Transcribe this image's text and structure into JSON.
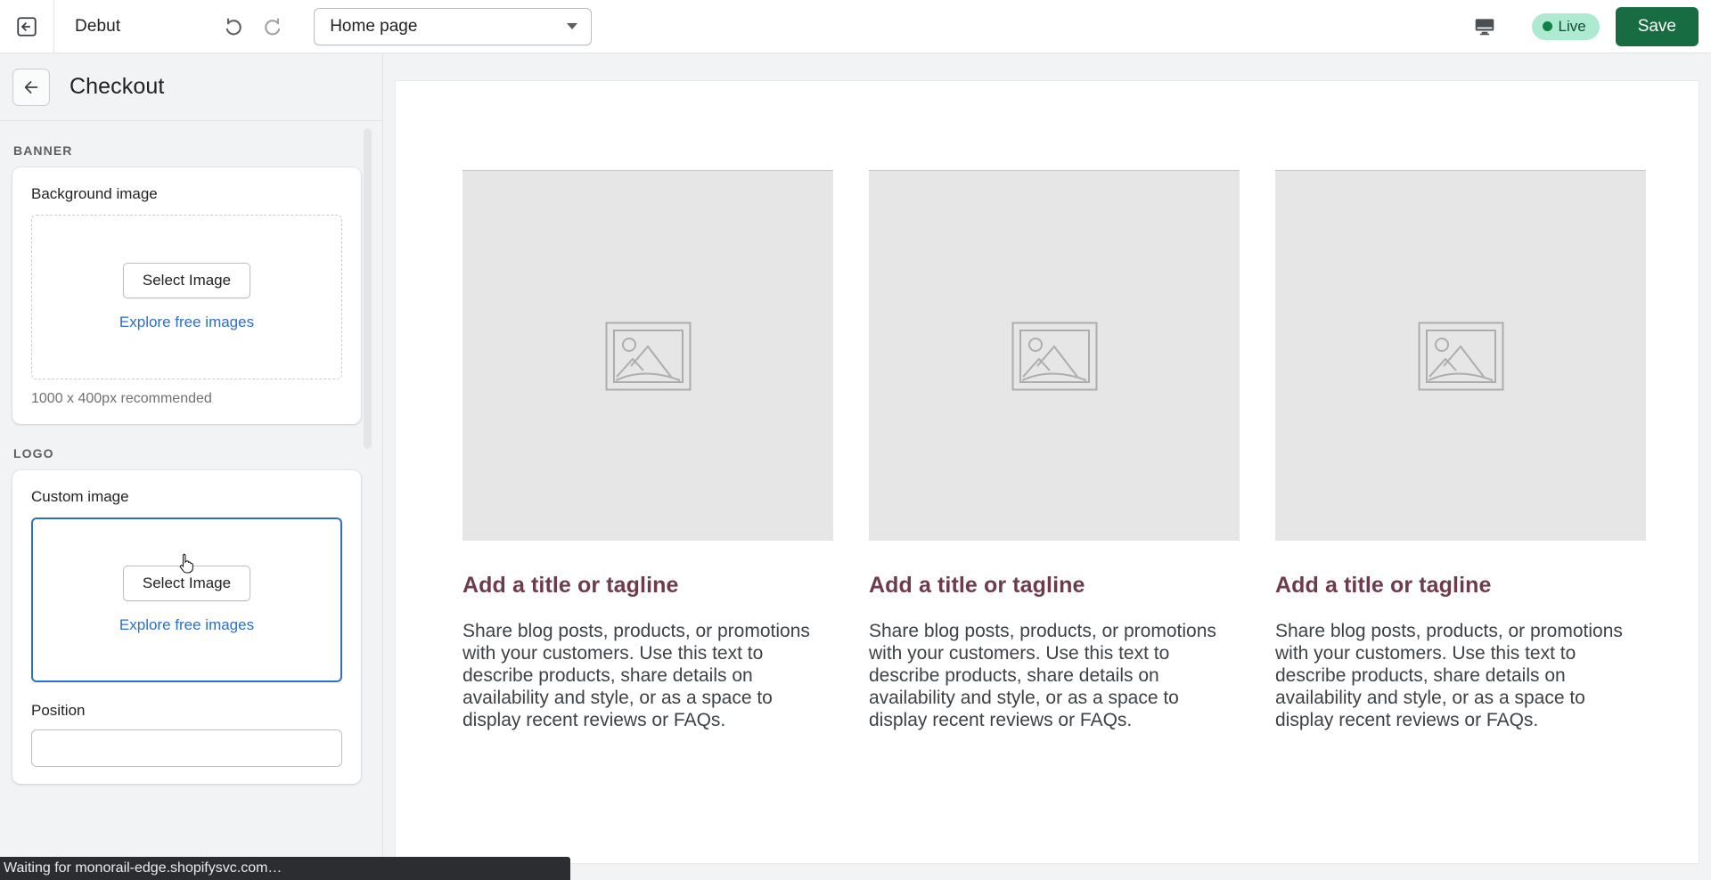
{
  "topbar": {
    "exit_icon": "exit-to-app-icon",
    "theme_name": "Debut",
    "undo_icon": "undo-icon",
    "redo_icon": "redo-icon",
    "page_select": {
      "value": "Home page",
      "caret_icon": "chevron-down-icon"
    },
    "device_icon": "desktop-monitor-icon",
    "live_badge": "Live",
    "save_label": "Save",
    "colors": {
      "save_bg": "#186c42",
      "live_bg": "#aee9d1",
      "live_dot": "#108043"
    }
  },
  "sidebar": {
    "back_icon": "arrow-left-icon",
    "title": "Checkout",
    "groups": [
      {
        "label": "BANNER",
        "field_label": "Background image",
        "select_image_label": "Select Image",
        "explore_label": "Explore free images",
        "helper_text": "1000 x 400px recommended",
        "focused": false
      },
      {
        "label": "LOGO",
        "field_label": "Custom image",
        "select_image_label": "Select Image",
        "explore_label": "Explore free images",
        "helper_text": "",
        "focused": true
      }
    ],
    "position_label": "Position",
    "link_color": "#2c6ecb",
    "focus_border_color": "#2c6ecb"
  },
  "preview": {
    "placeholder_icon": "image-placeholder-icon",
    "title_color": "#6d3b4a",
    "columns": [
      {
        "title": "Add a title or tagline",
        "body": "Share blog posts, products, or promotions with your customers. Use this text to describe products, share details on availability and style, or as a space to display recent reviews or FAQs."
      },
      {
        "title": "Add a title or tagline",
        "body": "Share blog posts, products, or promotions with your customers. Use this text to describe products, share details on availability and style, or as a space to display recent reviews or FAQs."
      },
      {
        "title": "Add a title or tagline",
        "body": "Share blog posts, products, or promotions with your customers. Use this text to describe products, share details on availability and style, or as a space to display recent reviews or FAQs."
      }
    ]
  },
  "statusbar": {
    "text": "Waiting for monorail-edge.shopifysvc.com…"
  }
}
